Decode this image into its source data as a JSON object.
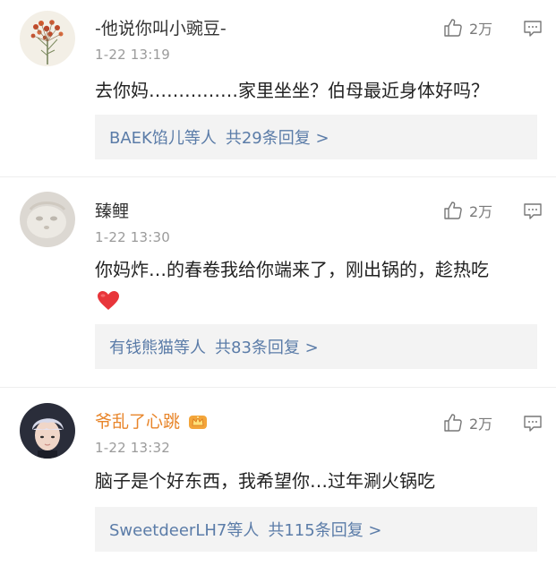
{
  "comments": [
    {
      "username": "-他说你叫小豌豆-",
      "time": "1-22 13:19",
      "likes": "2万",
      "text": "去你妈……………家里坐坐？伯母最近身体好吗？",
      "replies": {
        "names": "BAEK馅儿等人",
        "summary": "共29条回复 >"
      }
    },
    {
      "username": "臻鲤",
      "time": "1-22 13:30",
      "likes": "2万",
      "text": "你妈炸…的春卷我给你端来了，刚出锅的，趁热吃",
      "replies": {
        "names": "有钱熊猫等人",
        "summary": "共83条回复 >"
      }
    },
    {
      "username": "爷乱了心跳",
      "time": "1-22 13:32",
      "likes": "2万",
      "text": "脑子是个好东西，我希望你…过年涮火锅吃",
      "replies": {
        "names": "SweetdeerLH7等人",
        "summary": "共115条回复 >"
      }
    }
  ],
  "colors": {
    "link": "#5b7ca8",
    "vip_name": "#e8852a",
    "muted": "#9b9b9b",
    "heart": "#e8353a"
  },
  "icons": [
    "thumbs-up-icon",
    "comment-icon",
    "heart-icon",
    "crown-badge-icon"
  ]
}
